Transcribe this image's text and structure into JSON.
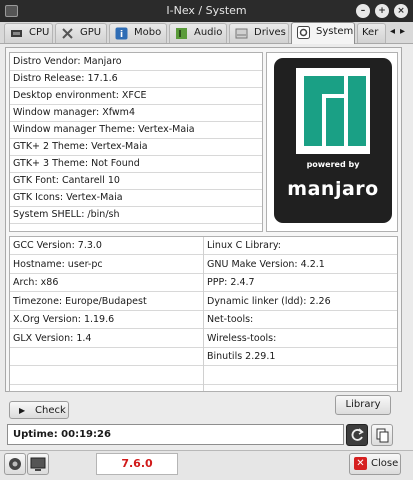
{
  "window": {
    "title": "I-Nex / System"
  },
  "tabs": [
    {
      "label": "CPU",
      "icon": "cpu-chip-icon"
    },
    {
      "label": "GPU",
      "icon": "gpu-tools-icon"
    },
    {
      "label": "Mobo",
      "icon": "info-icon"
    },
    {
      "label": "Audio",
      "icon": "audio-speaker-icon"
    },
    {
      "label": "Drives",
      "icon": "drive-icon"
    },
    {
      "label": "System",
      "icon": "system-gear-icon"
    },
    {
      "label": "Ker",
      "icon": "kernel-icon"
    }
  ],
  "active_tab": "System",
  "distro": [
    "Distro Vendor: Manjaro",
    "Distro Release: 17.1.6",
    "Desktop environment: XFCE",
    "Window manager: Xfwm4",
    "Window manager Theme: Vertex-Maia",
    "GTK+ 2 Theme: Vertex-Maia",
    "GTK+ 3 Theme: Not Found",
    "GTK Font: Cantarell 10",
    "GTK Icons: Vertex-Maia",
    "System SHELL: /bin/sh"
  ],
  "logo": {
    "powered_by": "powered by",
    "name": "manjaro",
    "brand_color": "#35bf5c",
    "teal": "#1aa085"
  },
  "system_left": [
    "GCC Version: 7.3.0",
    "Hostname: user-pc",
    "Arch: x86",
    "Timezone:  Europe/Budapest",
    "X.Org Version: 1.19.6",
    "GLX Version:  1.4",
    "",
    ""
  ],
  "system_right": [
    "Linux C Library:",
    "GNU Make Version: 4.2.1",
    "PPP: 2.4.7",
    "Dynamic linker (ldd): 2.26",
    "Net-tools:",
    "Wireless-tools:",
    "Binutils 2.29.1",
    ""
  ],
  "buttons": {
    "check": "Check",
    "library": "Library",
    "close": "Close"
  },
  "uptime": "Uptime: 00:19:26",
  "version": "7.6.0"
}
